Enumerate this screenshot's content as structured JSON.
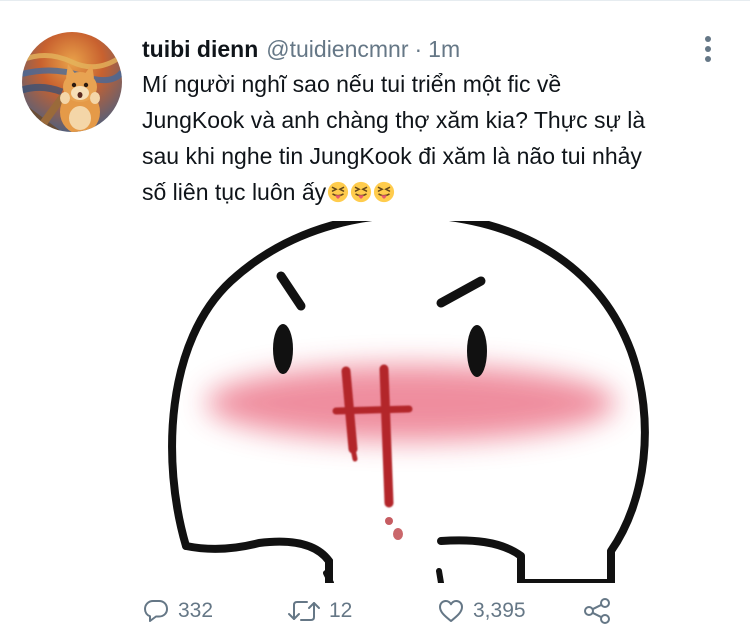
{
  "tweet": {
    "display_name": "tuibi dienn",
    "handle": "@tuidiencmnr",
    "separator": "·",
    "time": "1m",
    "text_lines": [
      "Mí người nghĩ sao nếu tui triển một fic về",
      "JungKook và anh chàng thợ xăm kia? Thực sự là",
      "sau khi nghe tin JungKook đi xăm là não tui nhảy",
      "số liên tục luôn ấy"
    ],
    "emojis": [
      "😝",
      "😝",
      "😝"
    ]
  },
  "actions": {
    "reply_count": "332",
    "retweet_count": "12",
    "like_count": "3,395"
  },
  "icons": {
    "avatar": "scream-cat-avatar",
    "more": "more-vertical-icon",
    "reply": "reply-icon",
    "retweet": "retweet-icon",
    "like": "heart-icon",
    "share": "share-icon"
  },
  "colors": {
    "text": "#0f1419",
    "muted": "#657786",
    "blush": "#ee8496",
    "blood": "#b3262c"
  }
}
